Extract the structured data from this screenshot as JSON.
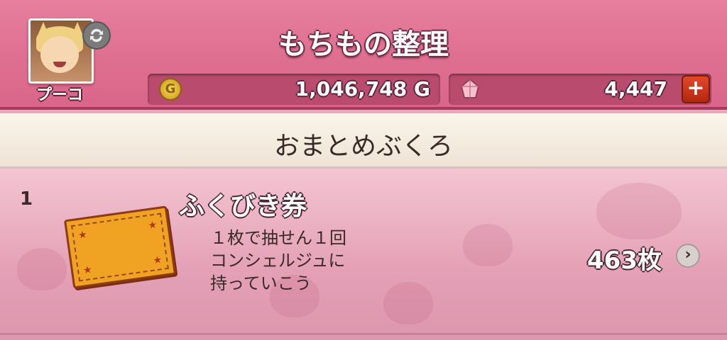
{
  "header": {
    "title": "もちもの整理",
    "player_name": "プーコ",
    "gold": {
      "amount": "1,046,748 G",
      "icon": "coin-icon"
    },
    "gems": {
      "amount": "4,447",
      "icon": "gem-icon",
      "add_label": "+"
    }
  },
  "category": {
    "title": "おまとめぶくろ"
  },
  "items": [
    {
      "index": "1",
      "name": "ふくびき券",
      "description": [
        "１枚で抽せん１回",
        "コンシェルジュに",
        "持っていこう"
      ],
      "count": "463枚",
      "arrow": "›"
    }
  ],
  "colors": {
    "header": "#df6f91",
    "category_bar": "#f5ede3",
    "content": "#e9a9bd"
  }
}
